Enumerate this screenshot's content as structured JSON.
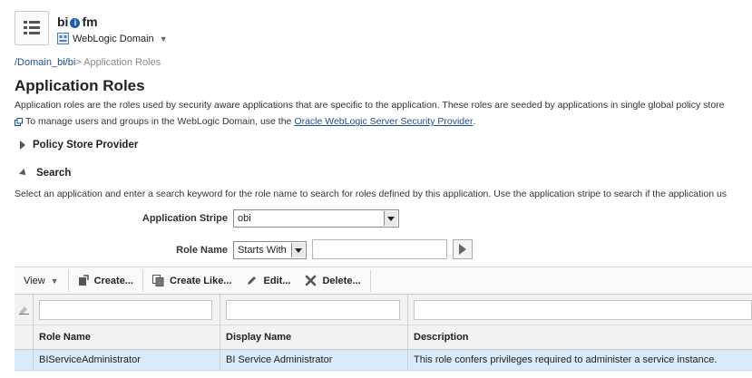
{
  "header": {
    "brand_prefix": "bi",
    "brand_info_glyph": "i",
    "brand_suffix": "fm",
    "domain_label": "WebLogic Domain",
    "logo_icon": "navigator-menu-icon"
  },
  "breadcrumb": {
    "link": "/Domain_bi/bi",
    "separator": ">",
    "current": "Application Roles"
  },
  "page": {
    "title": "Application Roles",
    "description": "Application roles are the roles used by security aware applications that are specific to the application. These roles are seeded by applications in single global policy store",
    "manage_text": "To manage users and groups in the WebLogic Domain, use the",
    "manage_link": "Oracle WebLogic Server Security Provider",
    "manage_end": "."
  },
  "sections": {
    "policy_store": "Policy Store Provider",
    "search": "Search"
  },
  "search": {
    "description": "Select an application and enter a search keyword for the role name to search for roles defined by this application. Use the application stripe to search if the application us",
    "stripe_label": "Application Stripe",
    "stripe_value": "obi",
    "role_label": "Role Name",
    "match_value": "Starts With",
    "role_value": ""
  },
  "toolbar": {
    "view": "View",
    "create": "Create...",
    "create_like": "Create Like...",
    "edit": "Edit...",
    "delete": "Delete..."
  },
  "table": {
    "columns": [
      "Role Name",
      "Display Name",
      "Description"
    ],
    "rows": [
      [
        "BIServiceAdministrator",
        "BI Service Administrator",
        "This role confers privileges required to administer a service instance."
      ]
    ]
  },
  "colors": {
    "link": "#1c4f8f",
    "selected_row": "#d9ebf9"
  }
}
